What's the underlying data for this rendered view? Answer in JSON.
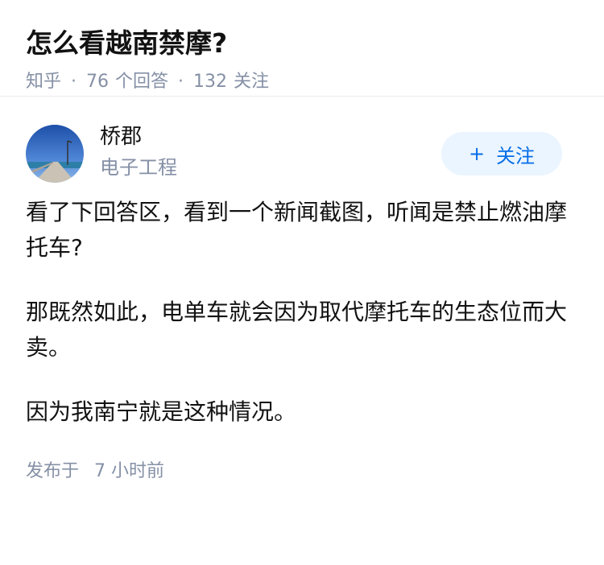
{
  "question": {
    "title": "怎么看越南禁摩?",
    "source": "知乎",
    "answer_count": "76",
    "answer_label": "个回答",
    "follower_count": "132",
    "follower_label": "关注"
  },
  "author": {
    "name": "桥郡",
    "headline": "电子工程",
    "follow_plus": "+",
    "follow_label": "关注"
  },
  "answer": {
    "paragraphs": [
      "看了下回答区，看到一个新闻截图，听闻是禁止燃油摩托车?",
      "那既然如此，电单车就会因为取代摩托车的生态位而大卖。",
      "因为我南宁就是这种情况。"
    ],
    "publish_prefix": "发布于",
    "publish_time": "7 小时前"
  },
  "colors": {
    "meta_gray": "#8590a6",
    "follow_bg": "#ebf5ff",
    "follow_text": "#056de8"
  }
}
